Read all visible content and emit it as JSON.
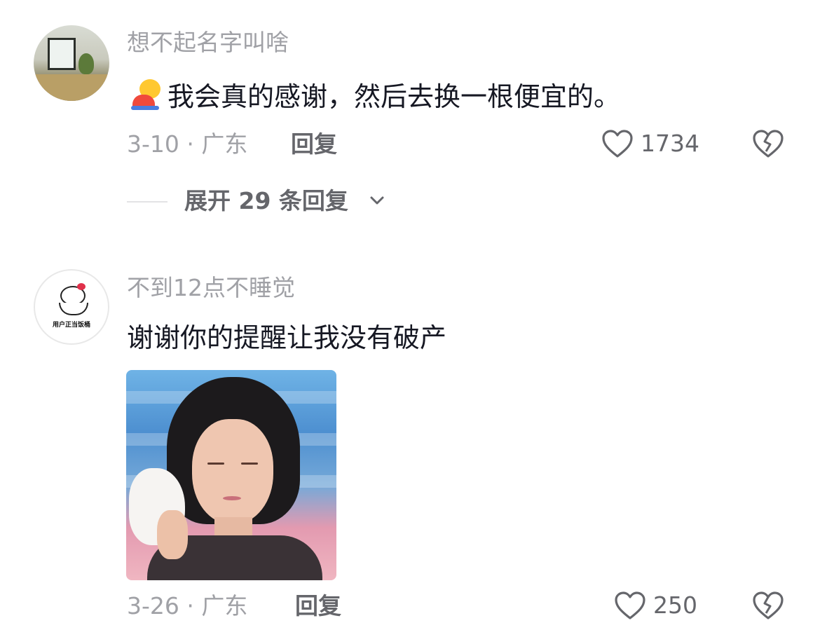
{
  "comments": [
    {
      "username": "想不起名字叫啥",
      "content": "我会真的感谢，然后去换一根便宜的。",
      "has_emoji": true,
      "emoji_icon": "person-bowing-emoji",
      "date_location": "3-10 · 广东",
      "reply_label": "回复",
      "likes": "1734",
      "expand_label": "展开 29 条回复"
    },
    {
      "username": "不到12点不睡觉",
      "avatar_text": "用户正当饭桶",
      "content": "谢谢你的提醒让我没有破产",
      "date_location": "3-26 · 广东",
      "reply_label": "回复",
      "likes": "250"
    }
  ],
  "colors": {
    "username": "#a0a1a6",
    "content": "#161823",
    "meta": "#a0a1a6",
    "action": "#65666b"
  }
}
